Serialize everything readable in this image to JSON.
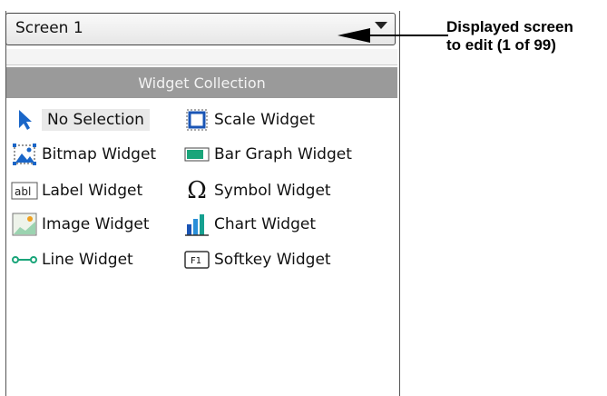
{
  "screen_select": {
    "value": "Screen 1"
  },
  "widget_collection": {
    "title": "Widget Collection",
    "items": [
      {
        "label": "No Selection",
        "icon": "pointer-arrow-icon"
      },
      {
        "label": "Scale Widget",
        "icon": "scale-icon"
      },
      {
        "label": "Bitmap Widget",
        "icon": "bitmap-icon"
      },
      {
        "label": "Bar Graph Widget",
        "icon": "bar-graph-icon"
      },
      {
        "label": "Label Widget",
        "icon": "label-abl-icon"
      },
      {
        "label": "Symbol Widget",
        "icon": "omega-symbol-icon"
      },
      {
        "label": "Image Widget",
        "icon": "image-icon"
      },
      {
        "label": "Chart Widget",
        "icon": "chart-icon"
      },
      {
        "label": "Line Widget",
        "icon": "line-icon"
      },
      {
        "label": "Softkey Widget",
        "icon": "softkey-f1-icon"
      }
    ]
  },
  "callout": {
    "line1": "Displayed screen",
    "line2": "to edit (1 of 99)"
  }
}
